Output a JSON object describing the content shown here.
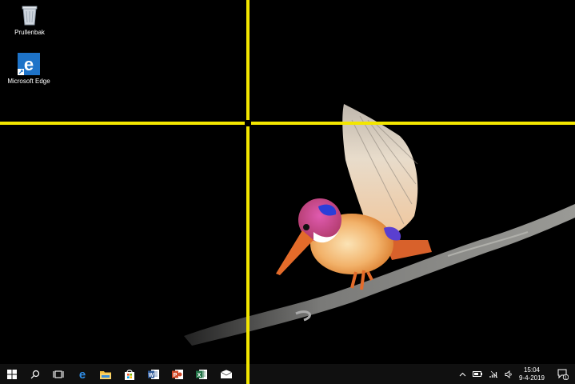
{
  "desktop": {
    "icons": [
      {
        "label": "Prullenbak",
        "icon": "recycle-bin-icon"
      },
      {
        "label": "Microsoft Edge",
        "icon": "edge-icon"
      }
    ]
  },
  "wallpaper": {
    "subject": "kingfisher-on-branch"
  },
  "taskbar": {
    "pinned": [
      {
        "name": "start",
        "icon": "windows-logo-icon"
      },
      {
        "name": "search",
        "icon": "search-icon"
      },
      {
        "name": "task-view",
        "icon": "task-view-icon"
      },
      {
        "name": "edge",
        "icon": "edge-icon"
      },
      {
        "name": "file-explorer",
        "icon": "folder-icon"
      },
      {
        "name": "store",
        "icon": "store-icon"
      },
      {
        "name": "word",
        "icon": "word-icon"
      },
      {
        "name": "powerpoint",
        "icon": "powerpoint-icon"
      },
      {
        "name": "excel",
        "icon": "excel-icon"
      },
      {
        "name": "mail",
        "icon": "mail-icon"
      }
    ],
    "tray": {
      "time": "15:04",
      "date": "9-4-2019",
      "notification_count": "1"
    }
  },
  "colors": {
    "guide": "#f3e600",
    "taskbar": "#101010",
    "edge_blue": "#1e73c8",
    "word_blue": "#2b5797",
    "powerpoint_red": "#d04a2a",
    "excel_green": "#217346"
  }
}
